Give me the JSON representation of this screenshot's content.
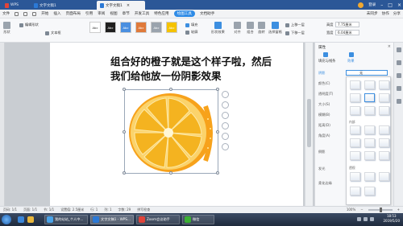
{
  "titlebar": {
    "tabs": [
      {
        "label": "WPS",
        "active": false
      },
      {
        "label": "文字文稿1",
        "active": false
      },
      {
        "label": "文字文稿1",
        "active": true
      }
    ],
    "user": "登录"
  },
  "menubar": {
    "file": "文件",
    "items": [
      "开始",
      "插入",
      "页面布局",
      "引用",
      "审阅",
      "视图",
      "章节",
      "开发工具",
      "特色应用",
      "绘图工具",
      "文档助手"
    ],
    "selected": "绘图工具",
    "right": [
      "未同步",
      "协作",
      "分享"
    ]
  },
  "ribbon": {
    "shape": "形状",
    "edit_shape": "编辑形状",
    "textbox": "文本框",
    "style_label": "Abc",
    "fill": "填充",
    "outline": "轮廓",
    "shape_effect": "形状效果",
    "align": "对齐",
    "group": "组合",
    "rotate": "旋转",
    "select_pane": "选择窗格",
    "bring_forward": "上移一层",
    "send_backward": "下移一层",
    "height_label": "高度",
    "height_value": "7.75厘米",
    "width_label": "宽度",
    "width_value": "6.04厘米"
  },
  "document": {
    "heading_line1": "组合好的橙子就是这个样子啦，然后",
    "heading_line2": "我们给他放一份阴影效果"
  },
  "pane": {
    "title": "属性",
    "tab_fill": "填充与线条",
    "tab_effect": "效果",
    "section": "阴影",
    "dropdown_value": "无",
    "labels": [
      "颜色(C)",
      "透明度(T)",
      "大小(S)",
      "模糊(B)",
      "距离(D)",
      "角度(A)",
      "倒影",
      "发光",
      "柔化边缘"
    ],
    "popup_headers": [
      "外部",
      "内部",
      "透视"
    ]
  },
  "status": {
    "page": "页码: 1/1",
    "pages": "页面: 1/1",
    "section": "节: 1/1",
    "setting": "设置值: 2.5厘米",
    "row": "行: 1",
    "col": "列: 1",
    "words": "字数: 29",
    "spell": "拼写检查",
    "zoom": "100%"
  },
  "taskbar": {
    "tasks": [
      "我的站站_个人中...",
      "文字文稿1 - WPS...",
      "Zoom会议助手",
      "微信"
    ],
    "time": "18:53",
    "date": "2019/5/20"
  },
  "colors": {
    "titlebar": "#2b5797",
    "accent": "#2e8be6",
    "orange": "#f7a21b",
    "orange_light": "#fbd36b"
  }
}
